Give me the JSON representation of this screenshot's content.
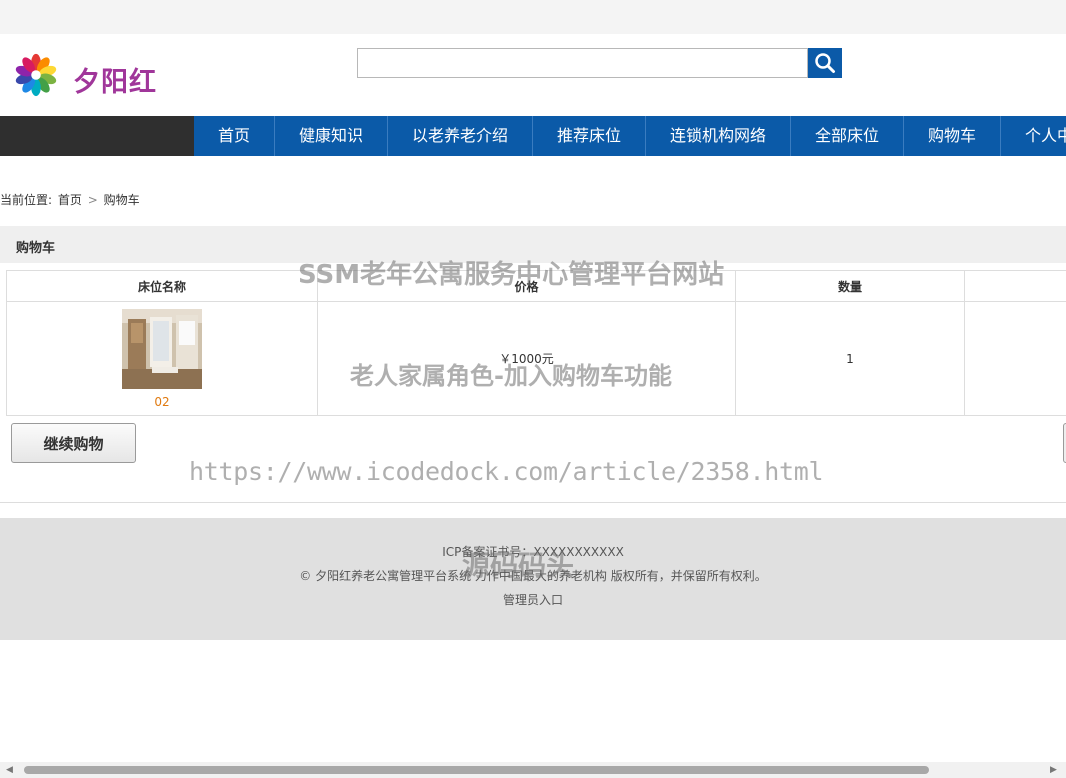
{
  "site": {
    "name": "夕阳红"
  },
  "search": {
    "value": "",
    "placeholder": ""
  },
  "nav": {
    "items": [
      "首页",
      "健康知识",
      "以老养老介绍",
      "推荐床位",
      "连锁机构网络",
      "全部床位",
      "购物车",
      "个人中心"
    ]
  },
  "breadcrumb": {
    "prefix": "当前位置:",
    "home": "首页",
    "separator": ">",
    "current": "购物车"
  },
  "cart": {
    "title": "购物车",
    "columns": [
      "床位名称",
      "价格",
      "数量",
      ""
    ],
    "rows": [
      {
        "name": "02",
        "price": "￥1000元",
        "quantity": "1"
      }
    ],
    "continue_label": "继续购物"
  },
  "footer": {
    "icp": "ICP备案证书号：XXXXXXXXXXX",
    "copyright": "© 夕阳红养老公寓管理平台系统 力作中国最大的养老机构 版权所有，并保留所有权利。",
    "admin_link": "管理员入口"
  },
  "watermarks": {
    "title": "SSM老年公寓服务中心管理平台网站",
    "subtitle": "老人家属角色-加入购物车功能",
    "url": "https://www.icodedock.com/article/2358.html",
    "brand": "源码码头"
  },
  "colors": {
    "nav_bg": "#0b5aa8",
    "brand": "#a0369a",
    "item_name": "#e07a10"
  },
  "icons": {
    "logo": "flower-logo",
    "search": "search-icon"
  }
}
